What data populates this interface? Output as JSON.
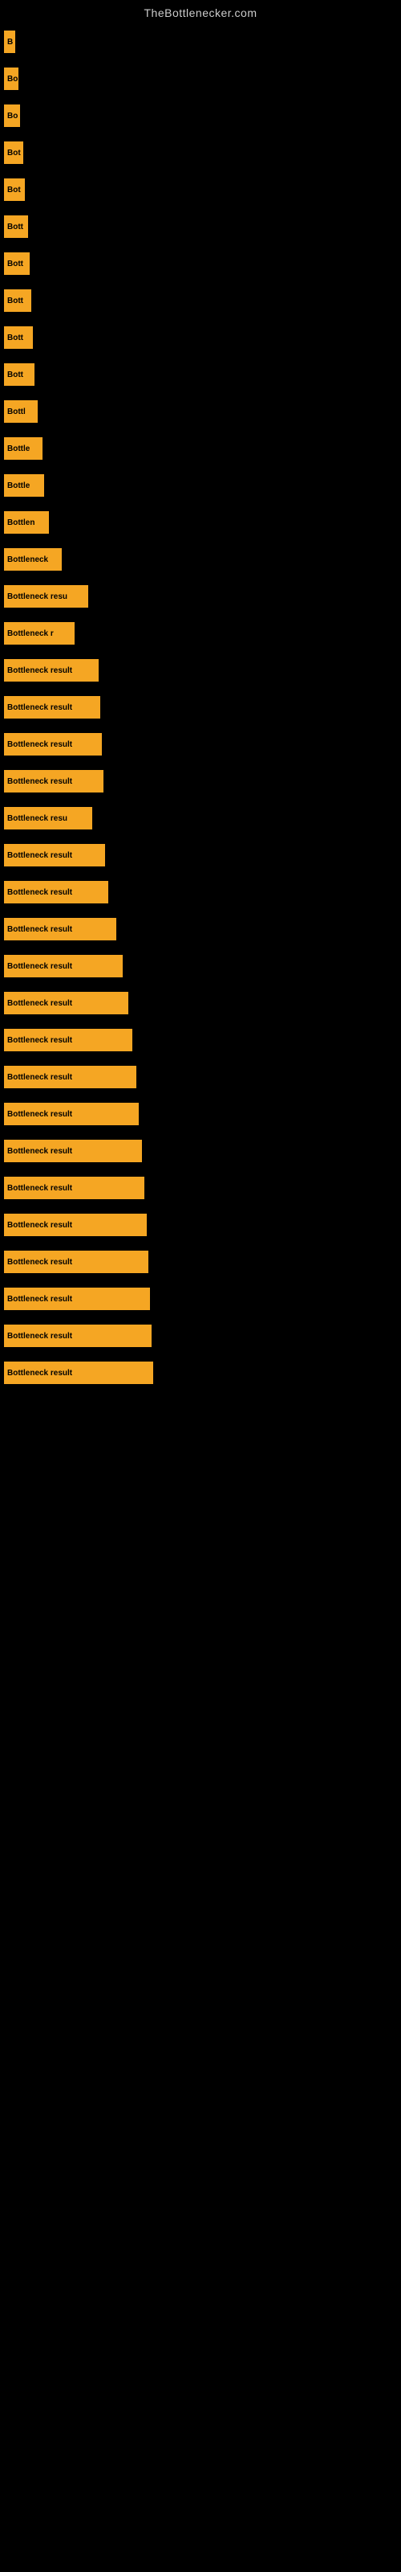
{
  "site": {
    "title": "TheBottlenecker.com"
  },
  "bars": [
    {
      "id": 1,
      "label": "B",
      "width": 14
    },
    {
      "id": 2,
      "label": "Bo",
      "width": 18
    },
    {
      "id": 3,
      "label": "Bo",
      "width": 20
    },
    {
      "id": 4,
      "label": "Bot",
      "width": 24
    },
    {
      "id": 5,
      "label": "Bot",
      "width": 26
    },
    {
      "id": 6,
      "label": "Bott",
      "width": 30
    },
    {
      "id": 7,
      "label": "Bott",
      "width": 32
    },
    {
      "id": 8,
      "label": "Bott",
      "width": 34
    },
    {
      "id": 9,
      "label": "Bott",
      "width": 36
    },
    {
      "id": 10,
      "label": "Bott",
      "width": 38
    },
    {
      "id": 11,
      "label": "Bottl",
      "width": 42
    },
    {
      "id": 12,
      "label": "Bottle",
      "width": 48
    },
    {
      "id": 13,
      "label": "Bottle",
      "width": 50
    },
    {
      "id": 14,
      "label": "Bottlen",
      "width": 56
    },
    {
      "id": 15,
      "label": "Bottleneck",
      "width": 72
    },
    {
      "id": 16,
      "label": "Bottleneck resu",
      "width": 105
    },
    {
      "id": 17,
      "label": "Bottleneck r",
      "width": 88
    },
    {
      "id": 18,
      "label": "Bottleneck result",
      "width": 118
    },
    {
      "id": 19,
      "label": "Bottleneck result",
      "width": 120
    },
    {
      "id": 20,
      "label": "Bottleneck result",
      "width": 122
    },
    {
      "id": 21,
      "label": "Bottleneck result",
      "width": 124
    },
    {
      "id": 22,
      "label": "Bottleneck resu",
      "width": 110
    },
    {
      "id": 23,
      "label": "Bottleneck result",
      "width": 126
    },
    {
      "id": 24,
      "label": "Bottleneck result",
      "width": 130
    },
    {
      "id": 25,
      "label": "Bottleneck result",
      "width": 140
    },
    {
      "id": 26,
      "label": "Bottleneck result",
      "width": 148
    },
    {
      "id": 27,
      "label": "Bottleneck result",
      "width": 155
    },
    {
      "id": 28,
      "label": "Bottleneck result",
      "width": 160
    },
    {
      "id": 29,
      "label": "Bottleneck result",
      "width": 165
    },
    {
      "id": 30,
      "label": "Bottleneck result",
      "width": 168
    },
    {
      "id": 31,
      "label": "Bottleneck result",
      "width": 172
    },
    {
      "id": 32,
      "label": "Bottleneck result",
      "width": 175
    },
    {
      "id": 33,
      "label": "Bottleneck result",
      "width": 178
    },
    {
      "id": 34,
      "label": "Bottleneck result",
      "width": 180
    },
    {
      "id": 35,
      "label": "Bottleneck result",
      "width": 182
    },
    {
      "id": 36,
      "label": "Bottleneck result",
      "width": 184
    },
    {
      "id": 37,
      "label": "Bottleneck result",
      "width": 186
    }
  ]
}
